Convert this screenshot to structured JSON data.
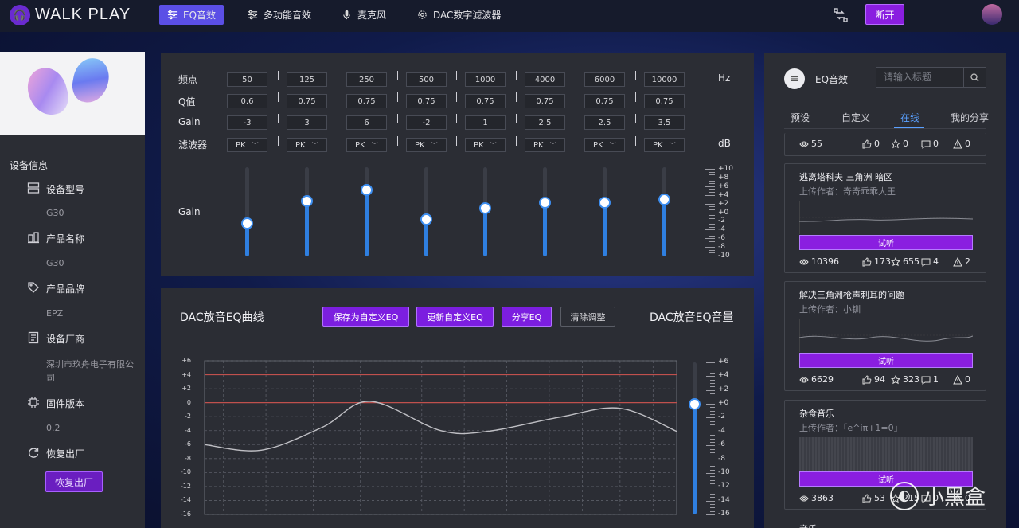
{
  "header": {
    "brand": "WALK PLAY",
    "tabs": [
      {
        "label": "EQ音效",
        "active": true
      },
      {
        "label": "多功能音效",
        "active": false
      },
      {
        "label": "麦克风",
        "active": false
      },
      {
        "label": "DAC数字滤波器",
        "active": false
      }
    ],
    "disconnect_label": "断开"
  },
  "sidebar": {
    "section_title": "设备信息",
    "items": [
      {
        "label": "设备型号",
        "value": "G30",
        "icon": "device-model-icon"
      },
      {
        "label": "产品名称",
        "value": "G30",
        "icon": "product-name-icon"
      },
      {
        "label": "产品品牌",
        "value": "EPZ",
        "icon": "brand-tag-icon"
      },
      {
        "label": "设备厂商",
        "value": "深圳市玖舟电子有限公司",
        "icon": "manufacturer-icon"
      },
      {
        "label": "固件版本",
        "value": "0.2",
        "icon": "firmware-chip-icon"
      },
      {
        "label": "恢复出厂",
        "value": "",
        "icon": "restore-icon"
      }
    ],
    "restore_button": "恢复出厂"
  },
  "eq": {
    "labels": {
      "freq": "频点",
      "q": "Q值",
      "gain": "Gain",
      "filter": "滤波器",
      "slider": "Gain"
    },
    "units": {
      "freq": "Hz",
      "gain": "dB"
    },
    "bands": [
      {
        "freq": "50",
        "q": "0.6",
        "gain": "-3",
        "filter": "PK",
        "level": -3
      },
      {
        "freq": "125",
        "q": "0.75",
        "gain": "3",
        "filter": "PK",
        "level": 3
      },
      {
        "freq": "250",
        "q": "0.75",
        "gain": "6",
        "filter": "PK",
        "level": 6
      },
      {
        "freq": "500",
        "q": "0.75",
        "gain": "-2",
        "filter": "PK",
        "level": -2
      },
      {
        "freq": "1000",
        "q": "0.75",
        "gain": "1",
        "filter": "PK",
        "level": 1
      },
      {
        "freq": "4000",
        "q": "0.75",
        "gain": "2.5",
        "filter": "PK",
        "level": 2.5
      },
      {
        "freq": "6000",
        "q": "0.75",
        "gain": "2.5",
        "filter": "PK",
        "level": 2.5
      },
      {
        "freq": "10000",
        "q": "0.75",
        "gain": "3.5",
        "filter": "PK",
        "level": 3.5
      }
    ],
    "scale": [
      "+10",
      "+8",
      "+6",
      "+4",
      "+2",
      "+0",
      "-2",
      "-4",
      "-6",
      "-8",
      "-10"
    ]
  },
  "curve": {
    "title": "DAC放音EQ曲线",
    "volume_title": "DAC放音EQ音量",
    "buttons": {
      "save": "保存为自定义EQ",
      "update": "更新自定义EQ",
      "share": "分享EQ",
      "clear": "清除调整"
    },
    "y_ticks": [
      "+6",
      "+4",
      "+2",
      "0",
      "-2",
      "-4",
      "-6",
      "-8",
      "-10",
      "-12",
      "-14",
      "-16"
    ],
    "volume_ticks": [
      "+6",
      "+4",
      "+2",
      "+0",
      "-2",
      "-4",
      "-6",
      "-8",
      "-10",
      "-12",
      "-14",
      "-16"
    ],
    "volume_level": 0,
    "limit_lines": [
      4,
      0
    ],
    "colors": {
      "limit": "#c0504d",
      "curve": "#bfbfc4"
    }
  },
  "chart_data": {
    "type": "line",
    "title": "DAC放音EQ曲线",
    "x": [
      0,
      0.12,
      0.25,
      0.35,
      0.5,
      0.6,
      0.75,
      0.88,
      1.0
    ],
    "y": [
      -6,
      -6.8,
      -3.5,
      0.2,
      -4,
      -4.1,
      -2.1,
      -0.8,
      -4.1
    ],
    "ylim": [
      -16,
      6
    ],
    "grid": true,
    "xlabel": "",
    "ylabel": ""
  },
  "right": {
    "heading": "EQ音效",
    "search_placeholder": "请输入标题",
    "tabs": [
      {
        "label": "预设",
        "active": false
      },
      {
        "label": "自定义",
        "active": false
      },
      {
        "label": "在线",
        "active": true
      },
      {
        "label": "我的分享",
        "active": false
      }
    ],
    "top_stats": {
      "views": "55",
      "likes": "0",
      "stars": "0",
      "comments": "0",
      "warnings": "0"
    },
    "cards": [
      {
        "title": "逃离塔科夫 三角洲 暗区",
        "author": "上传作者：奇奇乖乖大王",
        "listen": "试听",
        "views": "10396",
        "likes": "173",
        "stars": "655",
        "comments": "4",
        "warnings": "2"
      },
      {
        "title": "解决三角洲枪声刺耳的问题",
        "author": "上传作者：小钏",
        "listen": "试听",
        "views": "6629",
        "likes": "94",
        "stars": "323",
        "comments": "1",
        "warnings": "0"
      },
      {
        "title": "杂食音乐",
        "author": "上传作者：「e^iπ+1=0」",
        "listen": "试听",
        "views": "3863",
        "likes": "53",
        "stars": "215",
        "comments": "0",
        "warnings": "0"
      }
    ],
    "partial_title": "音乐"
  },
  "watermark": "小黑盒"
}
